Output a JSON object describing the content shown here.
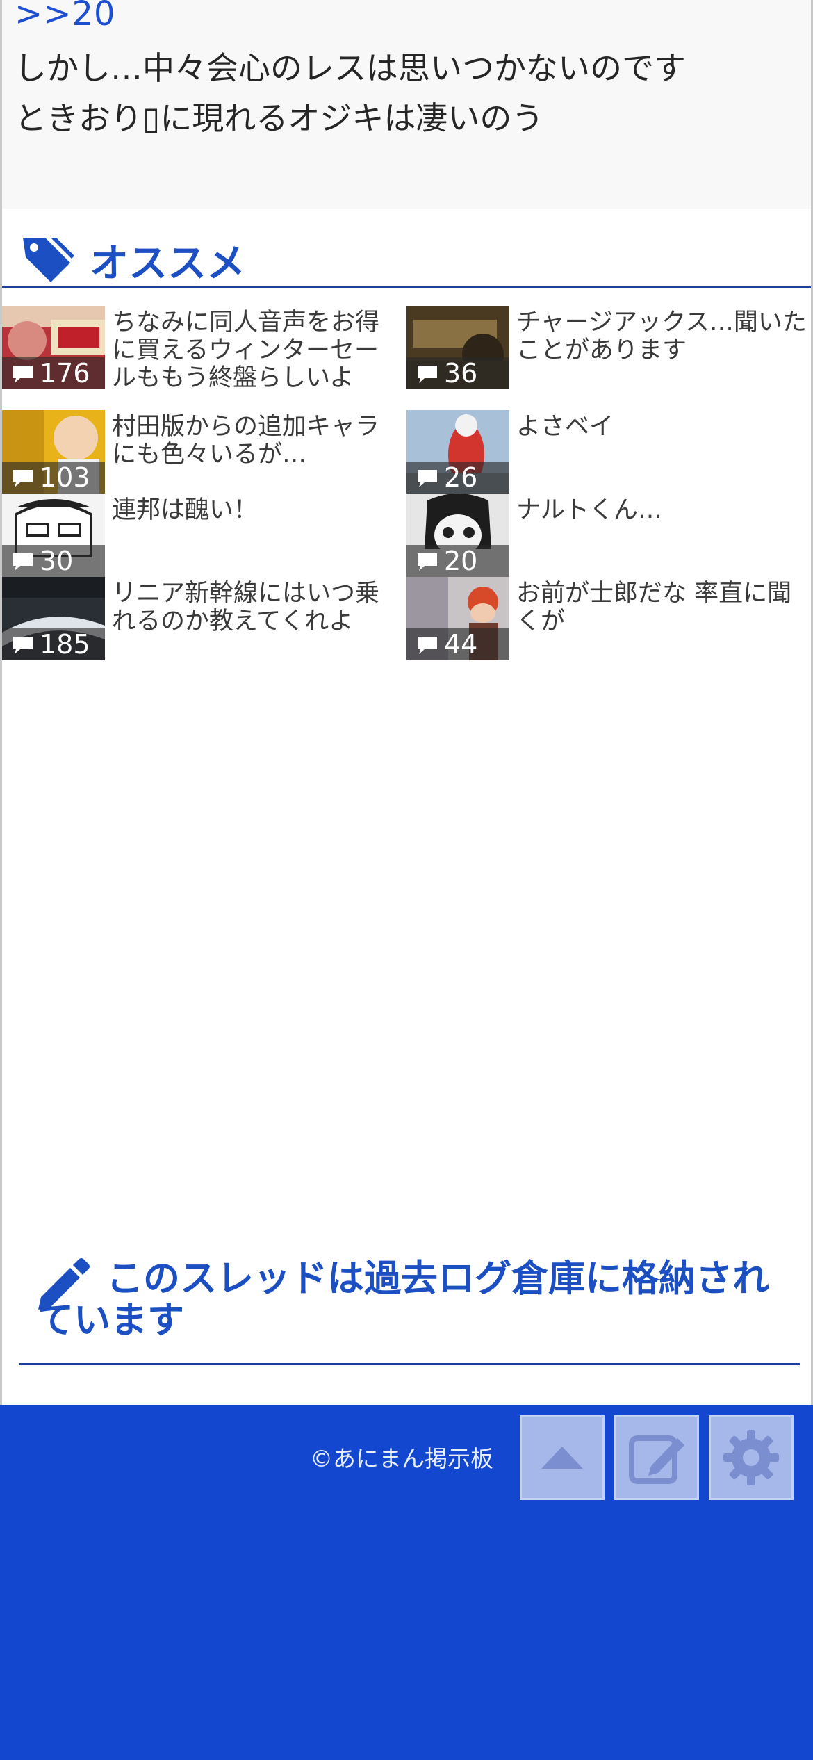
{
  "post": {
    "reply_ref": ">>20",
    "lines": [
      "しかし…中々会心のレスは思いつかないのです",
      "ときおり▯に現れるオジキは凄いのう"
    ]
  },
  "recommend": {
    "title": "オススメ",
    "items": [
      {
        "title": "ちなみに同人音声をお得に買えるウィンターセールももう終盤らしいよ",
        "count": "176"
      },
      {
        "title": "チャージアックス…聞いたことがあります",
        "count": "36"
      },
      {
        "title": "村田版からの追加キャラにも色々いるが…",
        "count": "103"
      },
      {
        "title": "よさベイ",
        "count": "26"
      },
      {
        "title": "連邦は醜い！",
        "count": "30"
      },
      {
        "title": "ナルトくん…",
        "count": "20"
      },
      {
        "title": "リニア新幹線にはいつ乗れるのか教えてくれよ",
        "count": "185"
      },
      {
        "title": "お前が士郎だな 率直に聞くが",
        "count": "44"
      }
    ]
  },
  "archive": {
    "message": "このスレッドは過去ログ倉庫に格納されています"
  },
  "footer": {
    "copyright": "©あにまん掲示板"
  },
  "colors": {
    "accent": "#1b4fc2",
    "footer_bg": "#1447cf",
    "button_bg": "#a6b8ea"
  },
  "icons": [
    "tag-icon",
    "comment-icon",
    "pencil-icon",
    "arrow-up-icon",
    "edit-icon",
    "gear-icon"
  ]
}
